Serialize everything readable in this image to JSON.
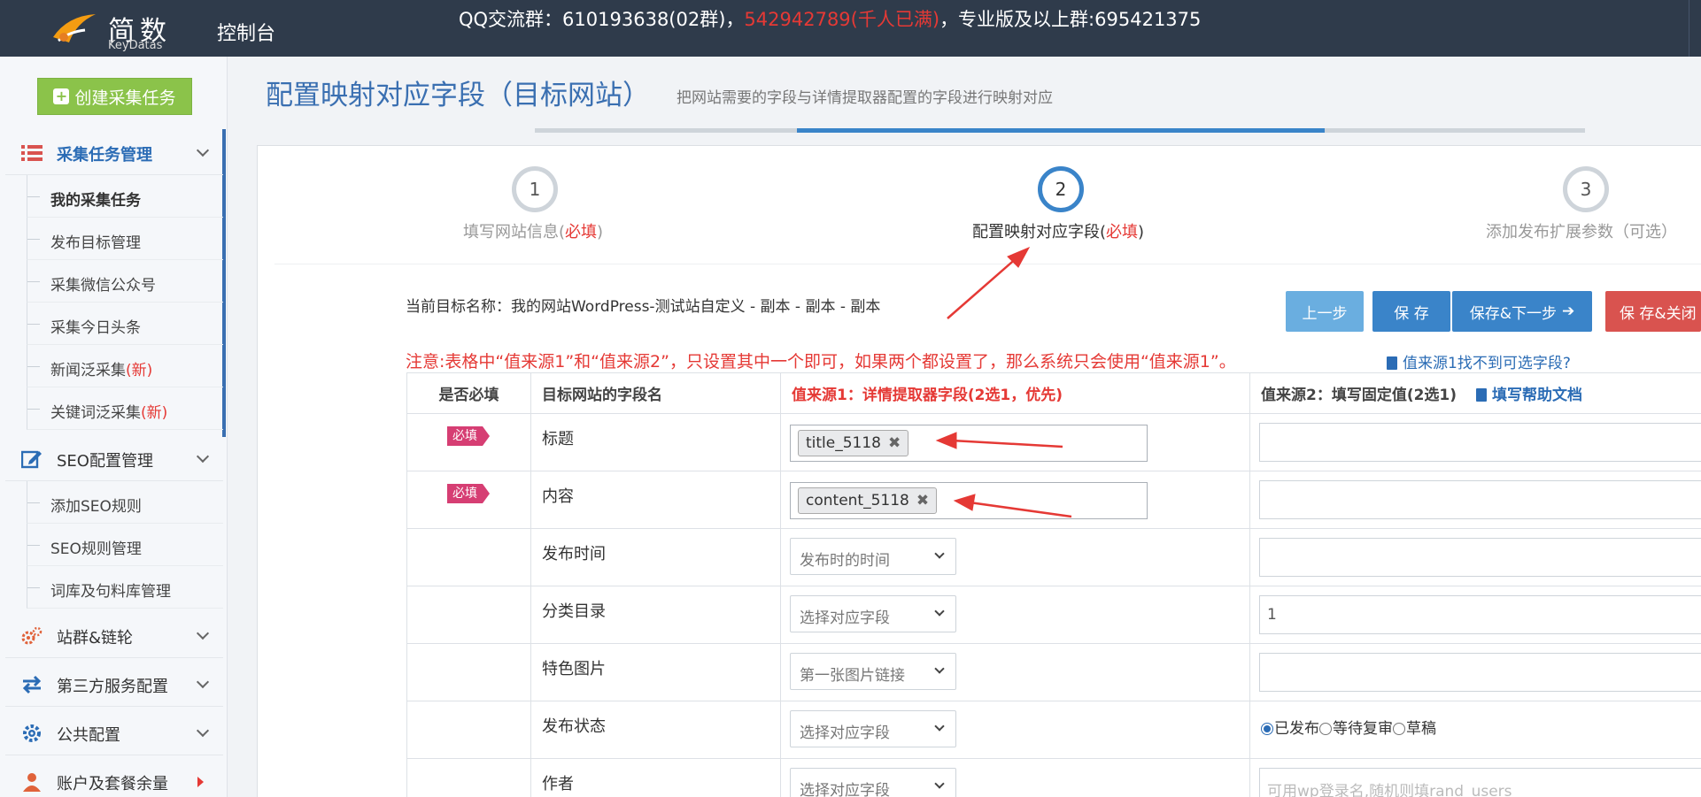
{
  "topbar": {
    "brand": "简数",
    "brand_sub": "KeyDatas",
    "console": "控制台",
    "qq_prefix": "QQ交流群：610193638(02群)，",
    "qq_full": "542942789(千人已满)",
    "qq_suffix": "，专业版及以上群:695421375"
  },
  "sidebar": {
    "create_button": "创建采集任务",
    "sections": [
      {
        "label": "采集任务管理",
        "icon": "list-icon"
      },
      {
        "label": "SEO配置管理",
        "icon": "edit-icon"
      },
      {
        "label": "站群&链轮",
        "icon": "gears-icon"
      },
      {
        "label": "第三方服务配置",
        "icon": "exchange-icon"
      },
      {
        "label": "公共配置",
        "icon": "gear-icon"
      },
      {
        "label": "账户及套餐余量",
        "icon": "user-icon"
      }
    ],
    "task_items": [
      "我的采集任务",
      "发布目标管理",
      "采集微信公众号",
      "采集今日头条",
      "新闻泛采集",
      "关键词泛采集"
    ],
    "new_badge": "(新)",
    "seo_items": [
      "添加SEO规则",
      "SEO规则管理",
      "词库及句料库管理"
    ]
  },
  "main": {
    "title": "配置映射对应字段（目标网站）",
    "description": "把网站需要的字段与详情提取器配置的字段进行映射对应",
    "steps": [
      {
        "num": "1",
        "label": "填写网站信息(",
        "req": "必填",
        "close": ")"
      },
      {
        "num": "2",
        "label": "配置映射对应字段(",
        "req": "必填",
        "close": ")"
      },
      {
        "num": "3",
        "label": "添加发布扩展参数（可选）"
      }
    ],
    "target_name": "当前目标名称：我的网站WordPress-测试站自定义 - 副本 - 副本 - 副本",
    "buttons": {
      "prev": "上一步",
      "save": "保 存",
      "save_next": "保存&下一步",
      "save_close": "保 存&关闭"
    },
    "notice": "注意:表格中“值来源1”和“值来源2”，只设置其中一个即可，如果两个都设置了，那么系统只会使用“值来源1”。",
    "notice_link": "值来源1找不到可选字段?",
    "table": {
      "headers": [
        "是否必填",
        "目标网站的字段名",
        "值来源1：详情提取器字段(2选1，优先)",
        "值来源2：填写固定值(2选1)"
      ],
      "help_doc": "填写帮助文档",
      "required_tag": "必填",
      "rows": [
        {
          "name": "标题",
          "chip": "title_5118"
        },
        {
          "name": "内容",
          "chip": "content_5118"
        },
        {
          "name": "发布时间",
          "select": "发布时的时间"
        },
        {
          "name": "分类目录",
          "select": "选择对应字段",
          "fixed": "1"
        },
        {
          "name": "特色图片",
          "select": "第一张图片链接"
        },
        {
          "name": "发布状态",
          "select": "选择对应字段",
          "radios": [
            "已发布",
            "等待复审",
            "草稿"
          ]
        },
        {
          "name": "作者",
          "select": "选择对应字段",
          "placeholder": "可用wp登录名,随机则填rand_users"
        }
      ]
    }
  }
}
